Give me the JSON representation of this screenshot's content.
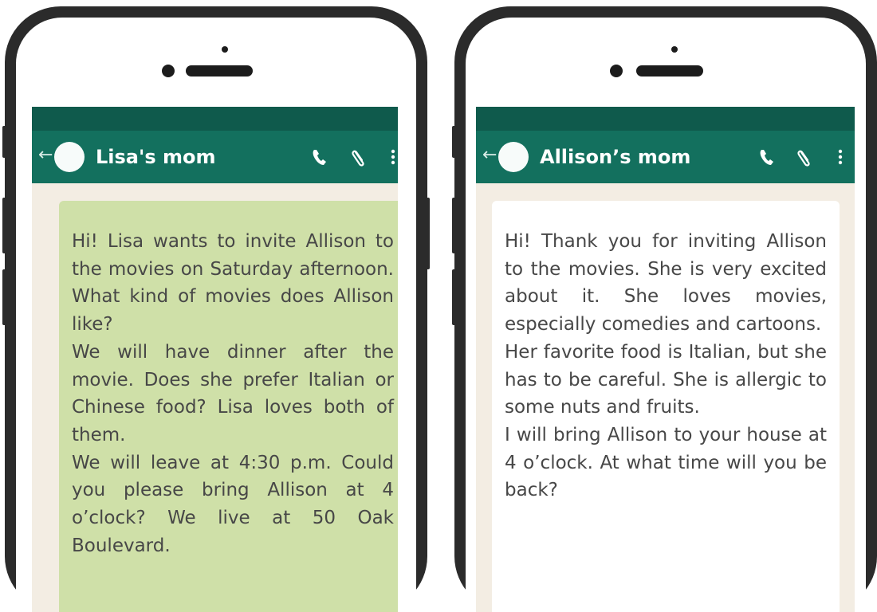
{
  "left_chat": {
    "contact_name": "Lisa's mom",
    "icons": [
      "back-arrow-icon",
      "avatar",
      "phone-icon",
      "paperclip-icon",
      "more-vertical-icon"
    ],
    "message_color": "#cfe0a8",
    "message": {
      "paragraphs": [
        "Hi! Lisa wants to invite Allison to the movies on Saturday afternoon. What kind of movies does Allison like?",
        "We will have dinner after the movie. Does she prefer Italian or Chinese food? Lisa loves both of them.",
        "We will leave at 4:30 p.m. Could you please bring Allison at 4 o’clock? We live at 50 Oak Boulevard."
      ]
    }
  },
  "right_chat": {
    "contact_name": "Allison’s mom",
    "icons": [
      "back-arrow-icon",
      "avatar",
      "phone-icon",
      "paperclip-icon",
      "more-vertical-icon"
    ],
    "message_color": "#ffffff",
    "message": {
      "paragraphs": [
        "Hi! Thank you for inviting Allison to the movies. She is very excited about it. She loves movies, especially comedies and cartoons.",
        "Her favorite food is Italian, but she has to be careful. She is allergic to some nuts and fruits.",
        "I will bring Allison to your house at 4 o’clock. At what time will you be back?"
      ]
    }
  },
  "colors": {
    "header": "#13705e",
    "status_bar": "#0f5a4c",
    "chat_background": "#f3ede3",
    "phone_frame": "#2b2b2b"
  }
}
